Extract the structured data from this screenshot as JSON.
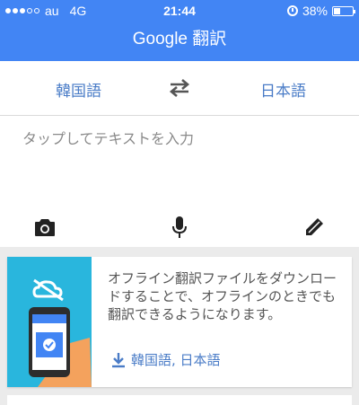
{
  "status_bar": {
    "carrier": "au",
    "network": "4G",
    "time": "21:44",
    "battery": "38%"
  },
  "app": {
    "title": "Google 翻訳"
  },
  "languages": {
    "source": "韓国語",
    "target": "日本語"
  },
  "input": {
    "placeholder": "タップしてテキストを入力"
  },
  "tools": [
    "camera-icon",
    "microphone-icon",
    "pen-icon"
  ],
  "offline_card": {
    "message": "オフライン翻訳ファイルをダウンロードすることで、オフラインのときでも翻訳できるようになります。",
    "download_label": "韓国語, 日本語"
  },
  "colors": {
    "primary": "#4285f4",
    "link": "#4a7cc7",
    "illustration_bg": "#29b6dd"
  }
}
